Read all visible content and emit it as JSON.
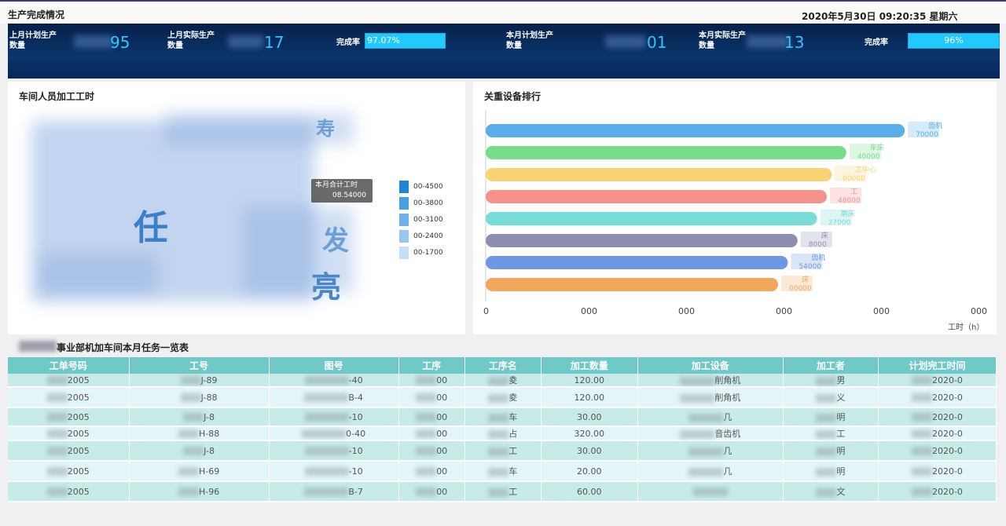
{
  "header": {
    "title": "生产完成情况",
    "datetime": "2020年5月30日 09:20:35 星期六"
  },
  "stats": {
    "last_plan_label": "上月计划生产数量",
    "last_plan_value": "95",
    "last_actual_label": "上月实际生产数量",
    "last_actual_value": "17",
    "last_rate_label": "完成率",
    "last_rate_value": "97.07%",
    "this_plan_label": "本月计划生产数量",
    "this_plan_value": "01",
    "this_actual_label": "本月实际生产数量",
    "this_actual_value": "13",
    "this_rate_label": "完成率",
    "this_rate_value": "96%",
    "last_rate_fraction": 0.9707,
    "this_rate_fraction": 0.96
  },
  "wordcloud": {
    "title": "车间人员加工工时",
    "words": [
      "亮",
      "发",
      "任",
      "寿"
    ],
    "tooltip_title": "本月合计工时",
    "tooltip_value": "08.54000",
    "legend": [
      "00-4500",
      "00-3800",
      "00-3100",
      "00-2400",
      "00-1700"
    ],
    "legend_colors": [
      "#1f86d6",
      "#4a9fe0",
      "#6fb2e6",
      "#96c7ee",
      "#c6dff5"
    ]
  },
  "equipment": {
    "title": "关重设备排行",
    "x_unit": "工时（h）",
    "x_ticks": [
      "0",
      "000",
      "000",
      "000",
      "000",
      "000"
    ],
    "bar_colors": [
      "#5aaeea",
      "#77dc8c",
      "#f9d272",
      "#f5928b",
      "#78dcd9",
      "#8d8fb0",
      "#6e97e6",
      "#f4a65d"
    ],
    "bar_labels": [
      "齿机",
      "车床",
      "工中心",
      "工",
      "磨床",
      "床",
      "齿机",
      "床"
    ],
    "bar_values": [
      "70000",
      "40000",
      "00000",
      "48000",
      "27000",
      "8000",
      "54000",
      "00000"
    ]
  },
  "chart_data": {
    "type": "bar",
    "title": "关重设备排行",
    "xlabel": "工时（h）",
    "categories": [
      "齿机",
      "车床",
      "工中心",
      "工",
      "磨床",
      "床",
      "齿机",
      "床"
    ],
    "values": [
      0.86,
      0.74,
      0.71,
      0.7,
      0.68,
      0.64,
      0.62,
      0.6
    ],
    "values_are_relative": true
  },
  "tasks": {
    "title": "事业部机加车间本月任务一览表",
    "columns": [
      "工单号码",
      "工号",
      "图号",
      "工序",
      "工序名",
      "加工数量",
      "加工设备",
      "加工者",
      "计划完工时间"
    ],
    "rows": [
      [
        "2005",
        "J-89",
        "-40",
        "00",
        "夌",
        "120.00",
        "削角机",
        "男",
        "2020-0"
      ],
      [
        "2005",
        "J-88",
        "B-4",
        "00",
        "夌",
        "120.00",
        "削角机",
        "义",
        "2020-0"
      ],
      [
        "2005",
        "J-8",
        "-10",
        "00",
        "车",
        "30.00",
        "几",
        "明",
        "2020-0"
      ],
      [
        "2005",
        "H-88",
        "0-40",
        "00",
        "占",
        "320.00",
        "音齿机",
        "工",
        "2020-0"
      ],
      [
        "2005",
        "J-8",
        "-10",
        "00",
        "工",
        "30.00",
        "几",
        "明",
        "2020-0"
      ],
      [
        "2005",
        "H-69",
        "-10",
        "00",
        "车",
        "20.00",
        "几",
        "明",
        "2020-0"
      ],
      [
        "2005",
        "H-96",
        "B-7",
        "00",
        "工",
        "60.00",
        "",
        "文",
        "2020-0"
      ]
    ]
  }
}
